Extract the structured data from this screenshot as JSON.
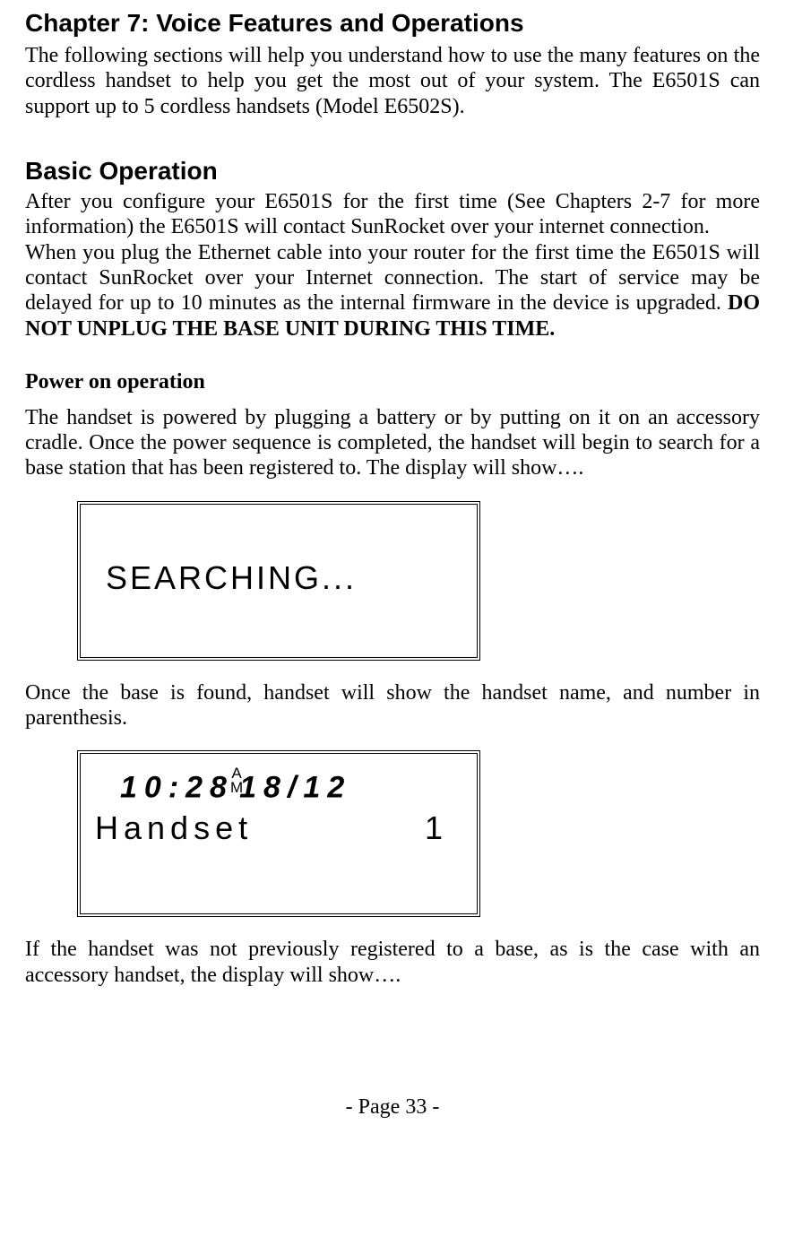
{
  "chapter_title": "Chapter 7: Voice Features and Operations",
  "intro_paragraph": "The following sections will help you understand how to use the many features on the cordless handset to help you get the most out of your system.  The E6501S can support up to 5 cordless handsets (Model E6502S).",
  "basic_operation_title": "Basic Operation",
  "basic_operation_p1": "After you configure your E6501S for the first time (See Chapters 2-7 for more information) the E6501S will contact SunRocket over your internet connection.",
  "basic_operation_p2_pre": "When you plug the Ethernet cable into your router for the first time the E6501S will contact SunRocket over your Internet connection. The start of service may be delayed for up to 10 minutes as the internal firmware in the device is upgraded. ",
  "basic_operation_p2_bold": "DO NOT UNPLUG THE BASE UNIT DURING THIS TIME.",
  "power_on_title": "Power on operation",
  "power_on_p1": "The handset is powered by plugging a battery or by putting on it on an accessory cradle. Once the power sequence is completed, the handset will begin to search for a base station that has been registered to. The display will show….",
  "lcd_searching_text": "SEARCHING...",
  "after_searching_text": "Once the base is found, handset will show the handset name, and number in parenthesis.",
  "lcd_idle": {
    "time": "10:28",
    "ampm_top": "A",
    "ampm_bottom": "M",
    "date": "18/12",
    "handset_label": "Handset",
    "handset_num": "1"
  },
  "after_idle_text": "If the handset was not previously registered to a base, as is the case with an accessory handset, the display will show….",
  "page_footer": "- Page 33 -"
}
